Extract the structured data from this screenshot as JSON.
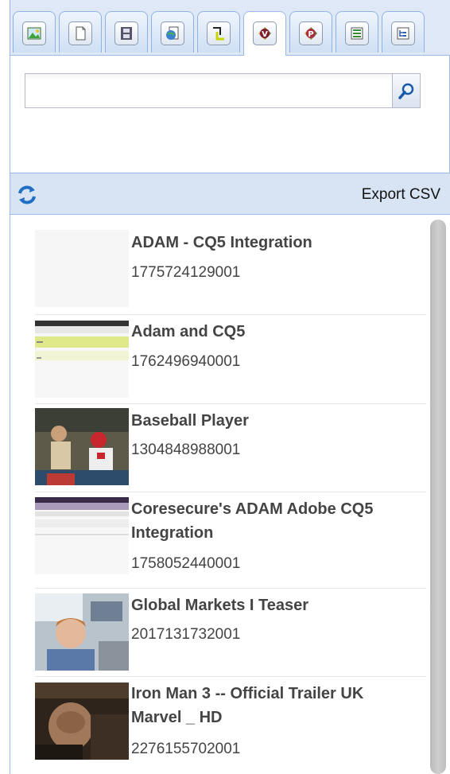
{
  "tabs": [
    {
      "name": "images",
      "icon": "image-icon",
      "active": false
    },
    {
      "name": "documents",
      "icon": "document-icon",
      "active": false
    },
    {
      "name": "movies",
      "icon": "film-icon",
      "active": false
    },
    {
      "name": "flash",
      "icon": "globe-doc-icon",
      "active": false
    },
    {
      "name": "paragraphs",
      "icon": "paragraph-icon",
      "active": false
    },
    {
      "name": "videos",
      "icon": "brightcove-video-icon",
      "active": true
    },
    {
      "name": "playlists",
      "icon": "brightcove-playlist-icon",
      "active": false
    },
    {
      "name": "products",
      "icon": "list-icon",
      "active": false
    },
    {
      "name": "site",
      "icon": "tree-icon",
      "active": false
    }
  ],
  "search": {
    "value": "",
    "placeholder": ""
  },
  "toolbar": {
    "export_label": "Export CSV",
    "refresh_icon": "refresh-icon"
  },
  "videos": [
    {
      "title": "ADAM - CQ5 Integration",
      "id": "1775724129001",
      "thumb": "blank"
    },
    {
      "title": "Adam and CQ5",
      "id": "1762496940001",
      "thumb": "screen-green"
    },
    {
      "title": "Baseball Player",
      "id": "1304848988001",
      "thumb": "baseball"
    },
    {
      "title": "Coresecure's ADAM Adobe CQ5 Integration",
      "id": "1758052440001",
      "thumb": "screen-purple"
    },
    {
      "title": "Global Markets I Teaser",
      "id": "2017131732001",
      "thumb": "office"
    },
    {
      "title": "Iron Man 3 -- Official Trailer UK Marvel _ HD",
      "id": "2276155702001",
      "thumb": "dark"
    }
  ],
  "colors": {
    "accent": "#99bbe8",
    "toolbar": "#d8e4f3",
    "text": "#444444"
  }
}
